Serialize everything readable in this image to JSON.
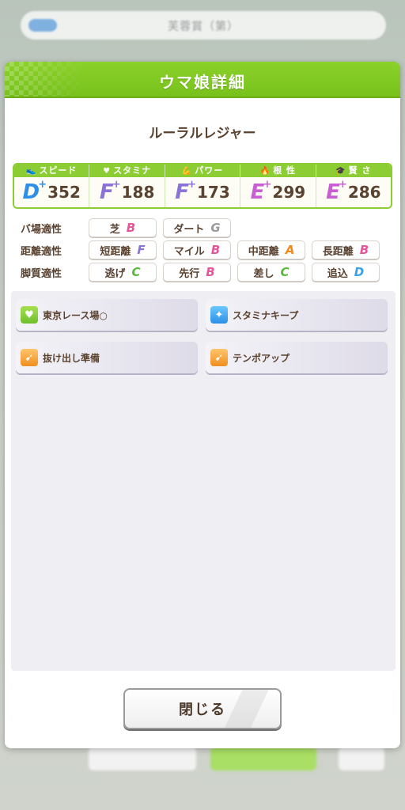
{
  "background": {
    "top_bar_text": "芙蓉賞（第）"
  },
  "modal": {
    "title": "ウマ娘詳細",
    "character_name": "ルーラルレジャー"
  },
  "stats": [
    {
      "label": "スピード",
      "icon": "shoe-icon",
      "rank": "D",
      "plus": "+",
      "value": "352"
    },
    {
      "label": "スタミナ",
      "icon": "heart-icon",
      "rank": "F",
      "plus": "+",
      "value": "188"
    },
    {
      "label": "パワー",
      "icon": "muscle-icon",
      "rank": "F",
      "plus": "+",
      "value": "173"
    },
    {
      "label": "根 性",
      "icon": "flame-icon",
      "rank": "E",
      "plus": "+",
      "value": "299"
    },
    {
      "label": "賢 さ",
      "icon": "mortarboard-icon",
      "rank": "E",
      "plus": "+",
      "value": "286"
    }
  ],
  "aptitude": {
    "track": {
      "label": "バ場適性",
      "items": [
        {
          "name": "芝",
          "grade": "B"
        },
        {
          "name": "ダート",
          "grade": "G"
        }
      ]
    },
    "distance": {
      "label": "距離適性",
      "items": [
        {
          "name": "短距離",
          "grade": "F"
        },
        {
          "name": "マイル",
          "grade": "B"
        },
        {
          "name": "中距離",
          "grade": "A"
        },
        {
          "name": "長距離",
          "grade": "B"
        }
      ]
    },
    "style": {
      "label": "脚質適性",
      "items": [
        {
          "name": "逃げ",
          "grade": "C"
        },
        {
          "name": "先行",
          "grade": "B"
        },
        {
          "name": "差し",
          "grade": "C"
        },
        {
          "name": "追込",
          "grade": "D"
        }
      ]
    }
  },
  "skills": [
    {
      "name": "東京レース場○",
      "icon": "heart-skill-icon",
      "color": "#7cc52c"
    },
    {
      "name": "スタミナキープ",
      "icon": "sparkle-skill-icon",
      "color": "#2a8fe6"
    },
    {
      "name": "抜け出し準備",
      "icon": "runner-skill-icon",
      "color": "#f08f1f"
    },
    {
      "name": "テンポアップ",
      "icon": "runner-skill-icon",
      "color": "#f08f1f"
    }
  ],
  "close_button": {
    "label": "閉じる"
  },
  "colors": {
    "header_green": "#7cc52c",
    "text_brown": "#5a4230"
  }
}
